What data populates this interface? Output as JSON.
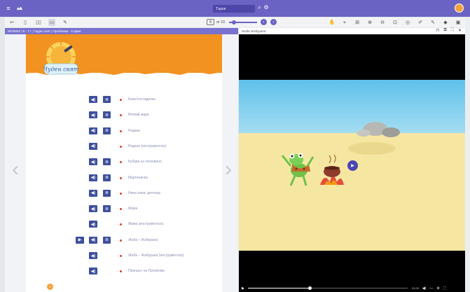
{
  "topbar": {
    "menu_icon": "hamburger-icon",
    "logo_icon": "app-logo-icon",
    "search_value": "Търси",
    "search_icon": "search-icon",
    "settings_icon": "gear-icon"
  },
  "toolbar": {
    "current_page": "8",
    "of_label": "от 10",
    "page_progress": 0.1,
    "prev_icon": "chevron-left-icon",
    "next_icon": "chevron-right-icon"
  },
  "left_page": {
    "breadcrumb": "МУЗИКА | 6 - 7 г. | Чуден свят | Проблема - София",
    "logo_text": "Чуден свят",
    "page_number": "4",
    "songs": [
      {
        "title": "Кака Костадинка",
        "has_play": false,
        "has_text": true
      },
      {
        "title": "Вятвай мари",
        "has_play": false,
        "has_text": true
      },
      {
        "title": "Родина",
        "has_play": false,
        "has_text": true
      },
      {
        "title": "Родина (инструментал)",
        "has_play": false,
        "has_text": false
      },
      {
        "title": "Кубава си татковино",
        "has_play": false,
        "has_text": true
      },
      {
        "title": "Мартеничка",
        "has_play": false,
        "has_text": true
      },
      {
        "title": "Нани нани, детенце",
        "has_play": false,
        "has_text": true
      },
      {
        "title": "Мама",
        "has_play": false,
        "has_text": true
      },
      {
        "title": "Мама (инструментал)",
        "has_play": false,
        "has_text": false
      },
      {
        "title": "Жаба – Жабурана",
        "has_play": true,
        "has_text": true
      },
      {
        "title": "Жаба – Жабурана (инструментал)",
        "has_play": false,
        "has_text": false
      },
      {
        "title": "Принцът на Прохелма",
        "has_play": false,
        "has_text": false
      }
    ]
  },
  "right_panel": {
    "title": "Жаба Жабурана",
    "header_icons": [
      "bookmark-icon",
      "external-link-icon",
      "fullscreen-icon",
      "close-icon"
    ],
    "player": {
      "time": "01:00",
      "progress": 0.39
    }
  },
  "colors": {
    "accent": "#6b63c3",
    "button_blue": "#3e4f9d",
    "orange": "#f29221",
    "bullet_red": "#e53b2f",
    "sand": "#f5e7a2",
    "sky": "#7ccfee"
  }
}
